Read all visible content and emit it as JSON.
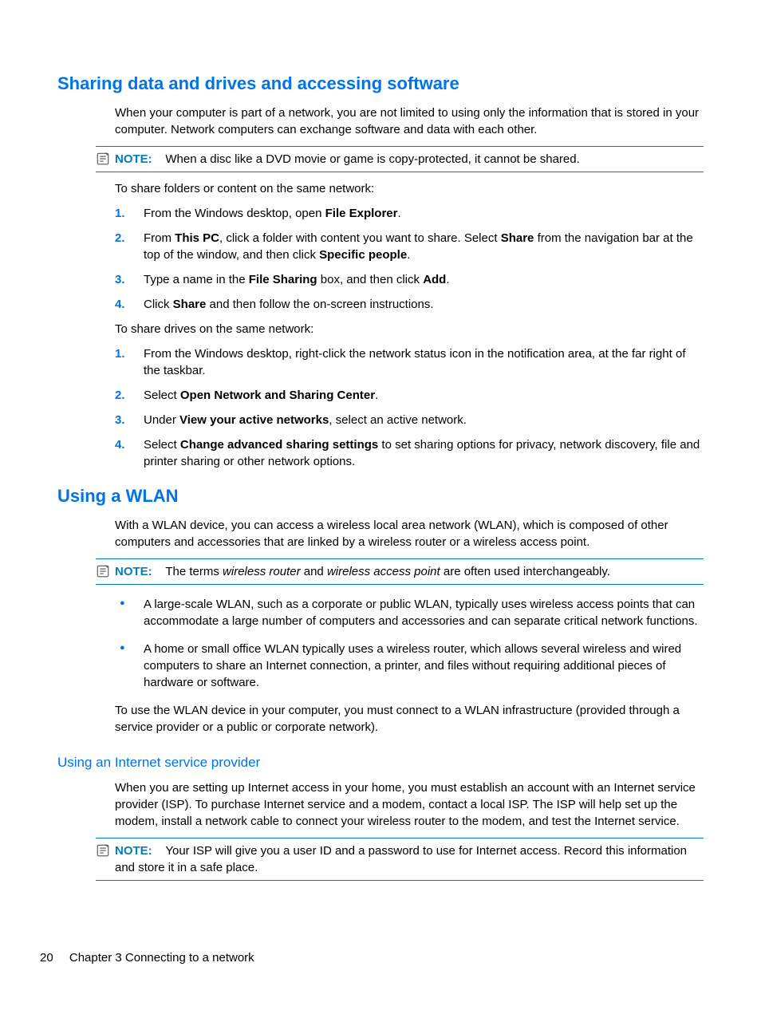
{
  "s1": {
    "title": "Sharing data and drives and accessing software",
    "intro": "When your computer is part of a network, you are not limited to using only the information that is stored in your computer. Network computers can exchange software and data with each other.",
    "note_label": "NOTE:",
    "note_text": "When a disc like a DVD movie or game is copy-protected, it cannot be shared.",
    "share_folders_intro": "To share folders or content on the same network:",
    "steps_folders": {
      "n1": "1.",
      "t1a": "From the Windows desktop, open ",
      "t1b": "File Explorer",
      "t1c": ".",
      "n2": "2.",
      "t2a": "From ",
      "t2b": "This PC",
      "t2c": ", click a folder with content you want to share. Select ",
      "t2d": "Share",
      "t2e": " from the navigation bar at the top of the window, and then click ",
      "t2f": "Specific people",
      "t2g": ".",
      "n3": "3.",
      "t3a": "Type a name in the ",
      "t3b": "File Sharing",
      "t3c": " box, and then click ",
      "t3d": "Add",
      "t3e": ".",
      "n4": "4.",
      "t4a": "Click ",
      "t4b": "Share",
      "t4c": " and then follow the on-screen instructions."
    },
    "share_drives_intro": "To share drives on the same network:",
    "steps_drives": {
      "n1": "1.",
      "t1": "From the Windows desktop, right-click the network status icon in the notification area, at the far right of the taskbar.",
      "n2": "2.",
      "t2a": "Select ",
      "t2b": "Open Network and Sharing Center",
      "t2c": ".",
      "n3": "3.",
      "t3a": "Under ",
      "t3b": "View your active networks",
      "t3c": ", select an active network.",
      "n4": "4.",
      "t4a": "Select ",
      "t4b": "Change advanced sharing settings",
      "t4c": " to set sharing options for privacy, network discovery, file and printer sharing or other network options."
    }
  },
  "s2": {
    "title": "Using a WLAN",
    "intro": "With a WLAN device, you can access a wireless local area network (WLAN), which is composed of other computers and accessories that are linked by a wireless router or a wireless access point.",
    "note_label": "NOTE:",
    "note_a": "The terms ",
    "note_b": "wireless router",
    "note_c": " and ",
    "note_d": "wireless access point",
    "note_e": " are often used interchangeably.",
    "bullets": {
      "b1": "A large-scale WLAN, such as a corporate or public WLAN, typically uses wireless access points that can accommodate a large number of computers and accessories and can separate critical network functions.",
      "b2": "A home or small office WLAN typically uses a wireless router, which allows several wireless and wired computers to share an Internet connection, a printer, and files without requiring additional pieces of hardware or software."
    },
    "outro": "To use the WLAN device in your computer, you must connect to a WLAN infrastructure (provided through a service provider or a public or corporate network)."
  },
  "s3": {
    "title": "Using an Internet service provider",
    "p1": "When you are setting up Internet access in your home, you must establish an account with an Internet service provider (ISP). To purchase Internet service and a modem, contact a local ISP. The ISP will help set up the modem, install a network cable to connect your wireless router to the modem, and test the Internet service.",
    "note_label": "NOTE:",
    "note_text": "Your ISP will give you a user ID and a password to use for Internet access. Record this information and store it in a safe place."
  },
  "footer": {
    "page": "20",
    "chapter": "Chapter 3   Connecting to a network"
  }
}
